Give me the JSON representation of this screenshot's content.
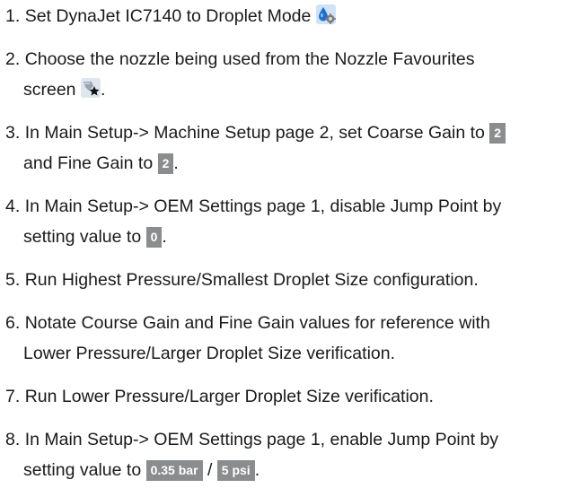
{
  "steps": [
    {
      "num": "1.",
      "text": "Set DynaJet IC7140 to Droplet Mode",
      "icon": "droplet-mode-icon"
    },
    {
      "num": "2.",
      "line1": "Choose the nozzle being used from the Nozzle Favourites",
      "line2": "screen",
      "end": ".",
      "icon": "nozzle-favourites-icon"
    },
    {
      "num": "3.",
      "line1": "In Main Setup-> Machine Setup page 2, set Coarse Gain to",
      "badge1": "2",
      "line2": "and Fine Gain to",
      "badge2": "2",
      "end": "."
    },
    {
      "num": "4.",
      "line1": "In Main Setup-> OEM Settings page 1, disable Jump Point by",
      "line2": "setting value to",
      "badge": "0",
      "end": "."
    },
    {
      "num": "5.",
      "text": "Run Highest Pressure/Smallest Droplet Size configuration."
    },
    {
      "num": "6.",
      "line1": "Notate Course Gain and Fine Gain values for reference with",
      "line2": "Lower Pressure/Larger Droplet Size verification."
    },
    {
      "num": "7.",
      "text": "Run Lower Pressure/Larger Droplet Size verification."
    },
    {
      "num": "8.",
      "line1": "In Main Setup-> OEM Settings page 1, enable Jump Point by",
      "line2": "setting value to",
      "badge1": "0.35 bar",
      "sep": "/",
      "badge2": "5 psi",
      "end": "."
    }
  ],
  "colors": {
    "badge_bg": "#8a8c8e",
    "text": "#1a1a1a"
  }
}
